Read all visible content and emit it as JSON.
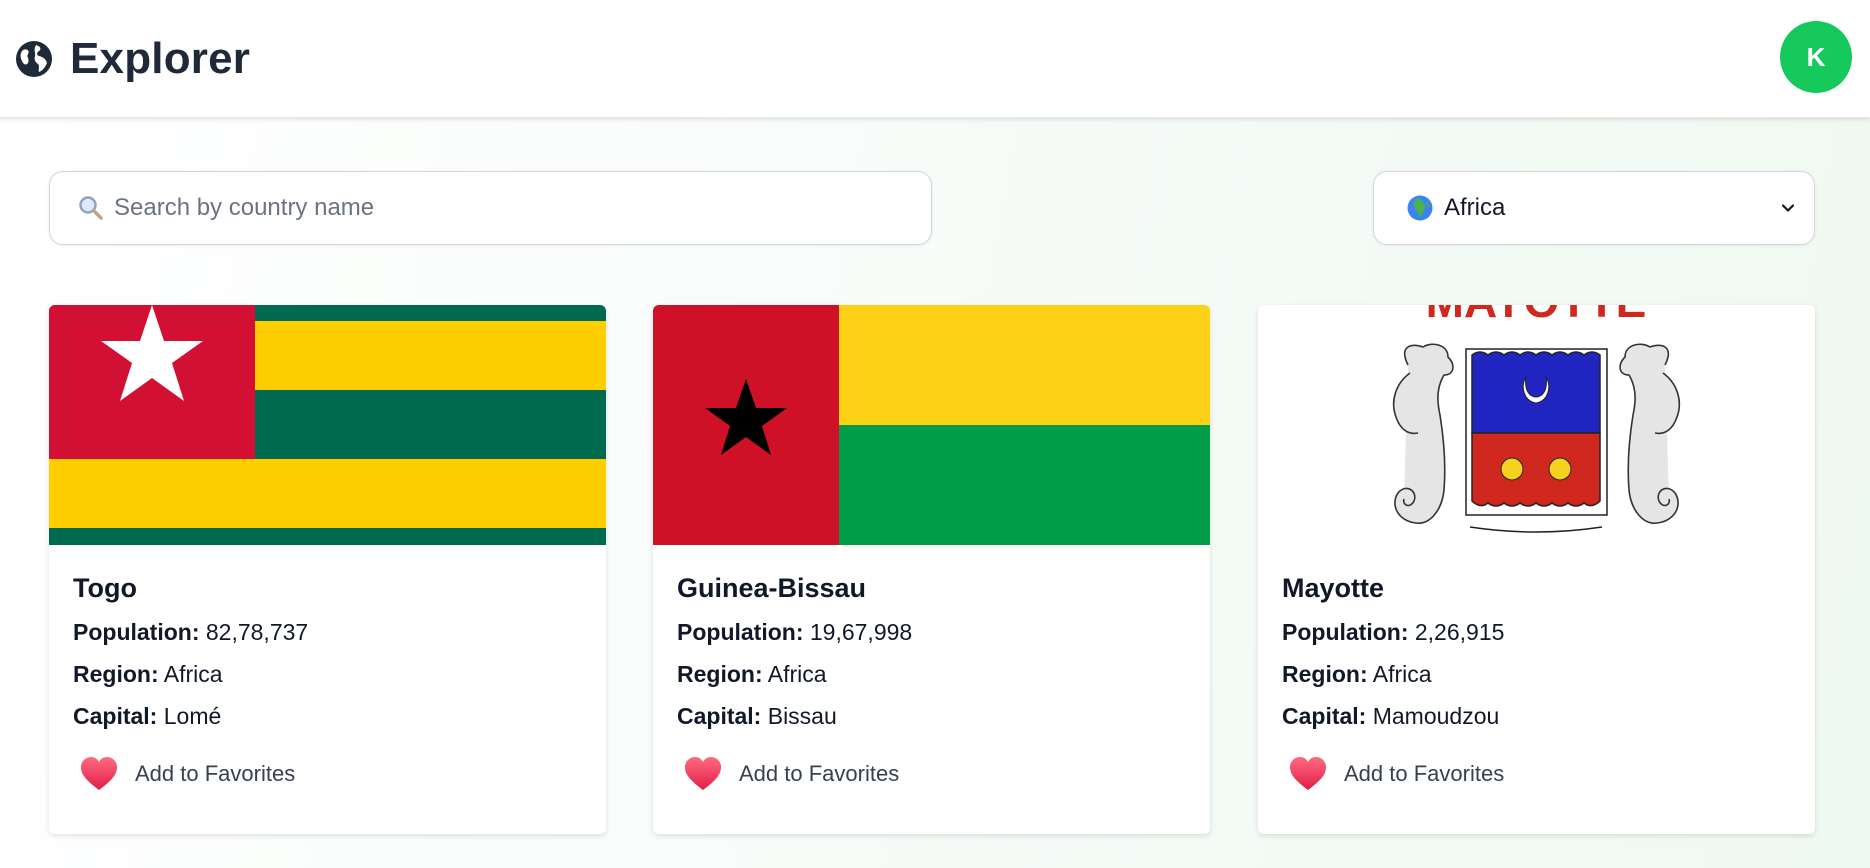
{
  "navbar": {
    "title": "Explorer",
    "avatar_letter": "K",
    "icon": "globe-icon"
  },
  "search": {
    "placeholder": "Search by country name",
    "value": "",
    "icon": "search-icon"
  },
  "region_filter": {
    "selected": "Africa",
    "icon": "globe-africa-icon"
  },
  "labels": {
    "population": "Population:",
    "region": "Region:",
    "capital": "Capital:",
    "favorite": "Add to Favorites"
  },
  "countries": [
    {
      "name": "Togo",
      "population": "82,78,737",
      "region": "Africa",
      "capital": "Lomé",
      "flag": "togo-flag"
    },
    {
      "name": "Guinea-Bissau",
      "population": "19,67,998",
      "region": "Africa",
      "capital": "Bissau",
      "flag": "guinea-bissau-flag"
    },
    {
      "name": "Mayotte",
      "population": "2,26,915",
      "region": "Africa",
      "capital": "Mamoudzou",
      "flag": "mayotte-flag",
      "flag_text": "MAYOTTE"
    }
  ],
  "colors": {
    "avatar": "#16c95d",
    "heart": "#f43f5e"
  }
}
